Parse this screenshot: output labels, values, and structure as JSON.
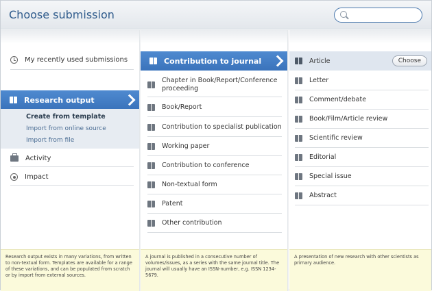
{
  "header": {
    "title": "Choose submission",
    "search_placeholder": "",
    "search_value": ""
  },
  "column1": {
    "recent_label": "My recently used submissions",
    "selected_label": "Research output",
    "sub_items": [
      "Create from template",
      "Import from online source",
      "Import from file"
    ],
    "activity_label": "Activity",
    "impact_label": "Impact",
    "footer": "Research output exists in many variations, from written to non-textual form. Templates are available for a range of these variations, and can be populated from scratch or by import from external sources."
  },
  "column2": {
    "selected_label": "Contribution to journal",
    "items": [
      "Chapter in Book/Report/Conference proceeding",
      "Book/Report",
      "Contribution to specialist publication",
      "Working paper",
      "Contribution to conference",
      "Non-textual form",
      "Patent",
      "Other contribution"
    ],
    "footer": "A journal is published in a consecutive number of volumes/issues, as a series with the same journal title. The journal will usually have an ISSN-number, e.g. ISSN 1234-5679."
  },
  "column3": {
    "selected_label": "Article",
    "choose_label": "Choose",
    "items": [
      "Letter",
      "Comment/debate",
      "Book/Film/Article review",
      "Scientific review",
      "Editorial",
      "Special issue",
      "Abstract"
    ],
    "footer": "A presentation of new research with other scientists as primary audience."
  },
  "colors": {
    "accent": "#3f7bc3",
    "title": "#2f5b8c",
    "footer_bg": "#fbfadb",
    "selected_light": "#dfe6ef"
  }
}
